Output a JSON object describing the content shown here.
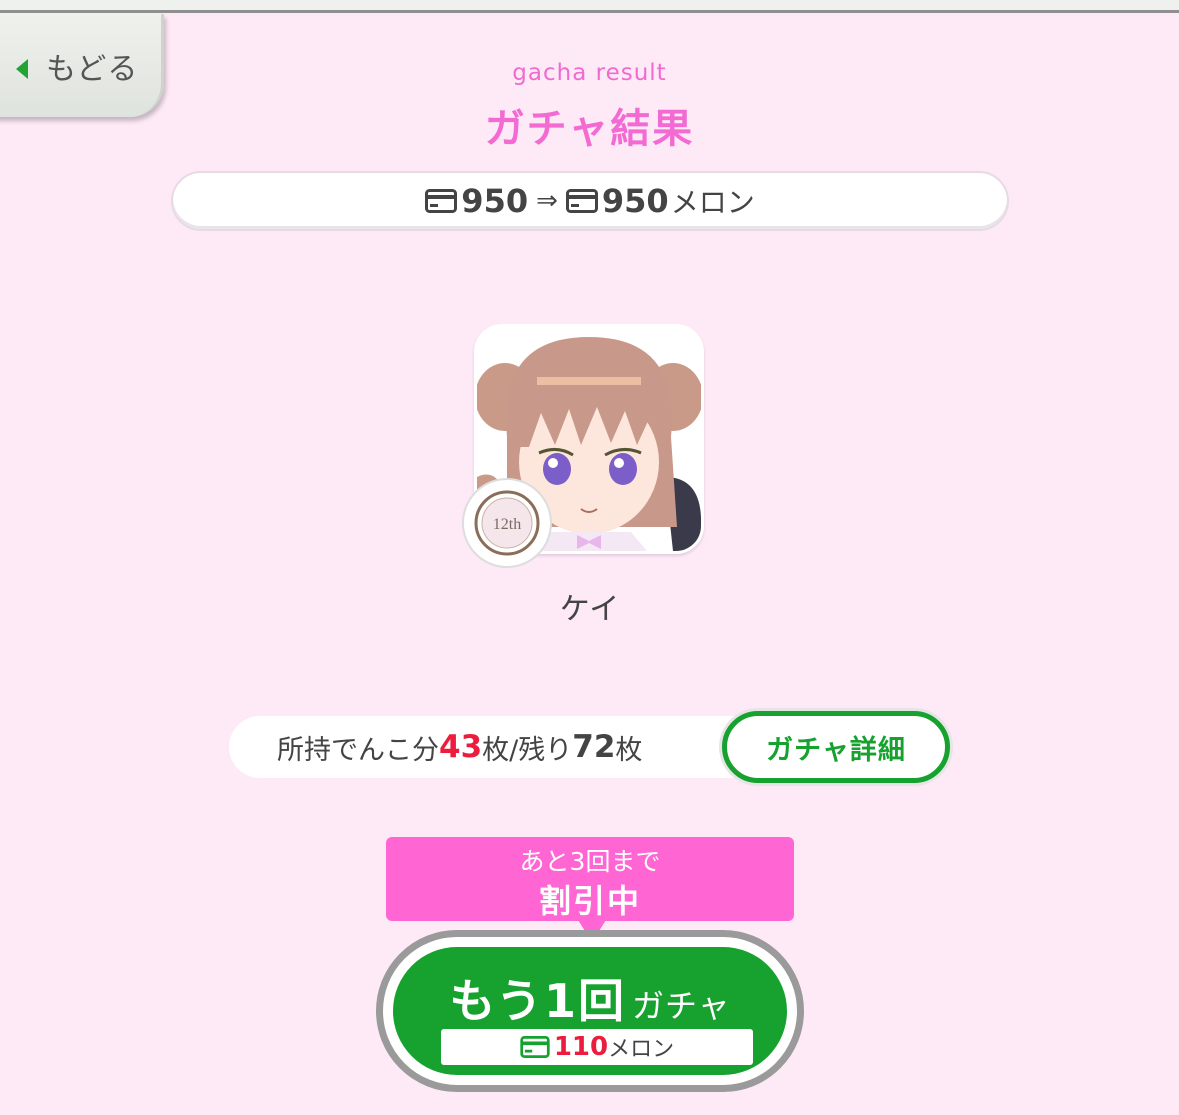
{
  "back": {
    "label": "もどる"
  },
  "header": {
    "subtitle": "gacha result",
    "title": "ガチャ結果"
  },
  "balance": {
    "before": "950",
    "arrow": "⇒",
    "after": "950",
    "unit": "メロン"
  },
  "character": {
    "name": "ケイ",
    "badge_text": "12th"
  },
  "collection": {
    "prefix": "所持でんこ分",
    "owned": "43",
    "mid": "枚/残り",
    "remaining": "72",
    "suffix": "枚"
  },
  "detail_button": {
    "label": "ガチャ詳細"
  },
  "discount": {
    "line1": "あと3回まで",
    "line2": "割引中"
  },
  "again_button": {
    "big": "もう1回",
    "small": "ガチャ",
    "price": "110",
    "unit": "メロン"
  },
  "colors": {
    "accent_pink": "#f36ad3",
    "green": "#17a12f",
    "red": "#ec1c3e",
    "discount_pink": "#ff66d4"
  }
}
